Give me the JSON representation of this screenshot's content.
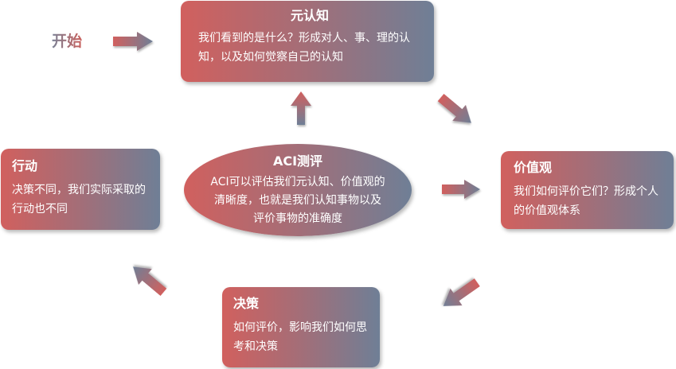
{
  "start": {
    "label": "开始"
  },
  "nodes": {
    "meta": {
      "title": "元认知",
      "text": "我们看到的是什么？形成对人、事、理的认知，以及如何觉察自己的认知"
    },
    "values": {
      "title": "价值观",
      "text": "我们如何评价它们？形成个人的价值观体系"
    },
    "decision": {
      "title": "决策",
      "text": "如何评价，影响我们如何思考和决策"
    },
    "action": {
      "title": "行动",
      "text": "决策不同，我们实际采取的行动也不同"
    }
  },
  "center": {
    "title": "ACI测评",
    "text": "ACI可以评估我们元认知、价值观的清晰度，也就是我们认知事物以及评价事物的准确度"
  },
  "colors": {
    "gradient_start": "#d1605e",
    "gradient_end": "#6f7f96"
  }
}
